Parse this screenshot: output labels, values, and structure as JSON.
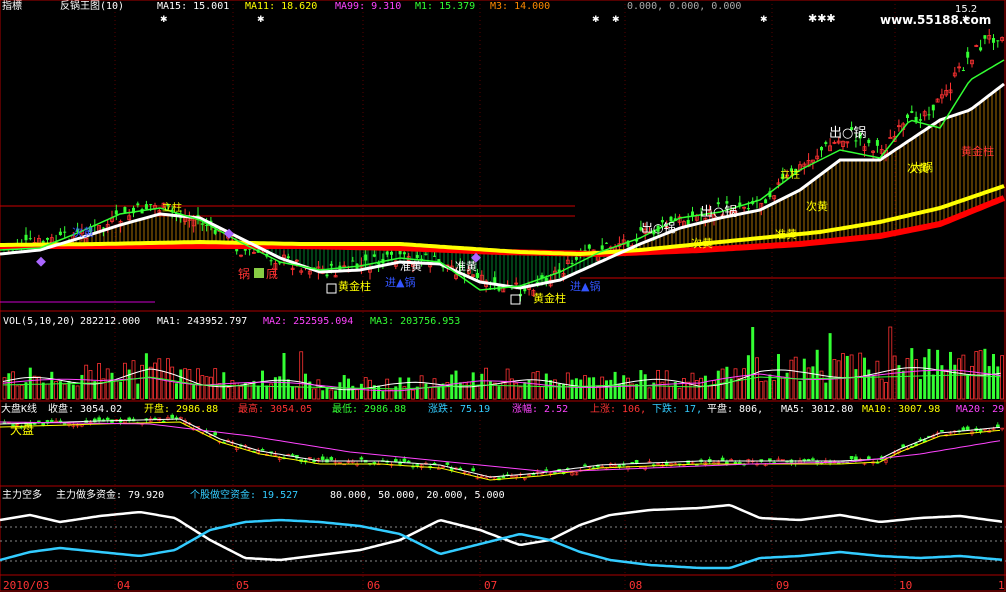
{
  "header": {
    "prefix": "指標",
    "name": "反锅王图(10)",
    "ma15": "MA15: 15.001",
    "ma11": "MA11: 18.620",
    "ma99": "MA99: 9.310",
    "m1": "M1: 15.379",
    "m3": "M3: 14.000",
    "vals": "0.000, 0.000, 0.000",
    "watermark": "www.55188.com",
    "last_price": "15.2"
  },
  "price_annotations": [
    {
      "text": "出○锅",
      "color": "#ffffff"
    },
    {
      "text": "出○锅",
      "color": "#ffffff"
    },
    {
      "text": "出○锅",
      "color": "#ffffff"
    },
    {
      "text": "次黄",
      "color": "#ffff00"
    },
    {
      "text": "准黄",
      "color": "#ffff00"
    },
    {
      "text": "次黄",
      "color": "#ffff00"
    },
    {
      "text": "次黄",
      "color": "#ffff00"
    },
    {
      "text": "准黄",
      "color": "#ffffff"
    },
    {
      "text": "准黄",
      "color": "#ffffff"
    },
    {
      "text": "黄金柱",
      "color": "#ffff00"
    },
    {
      "text": "黄金柱",
      "color": "#ffff00"
    },
    {
      "text": "锅",
      "color": "#ff3333"
    },
    {
      "text": "底",
      "color": "#ff3333"
    },
    {
      "text": "进▲锅",
      "color": "#3355ff"
    },
    {
      "text": "进▲锅",
      "color": "#3355ff"
    },
    {
      "text": "立柱",
      "color": "#ffff00"
    },
    {
      "text": "立柱",
      "color": "#ffff00"
    },
    {
      "text": "黄金柱",
      "color": "#ff3333"
    },
    {
      "text": "大锅",
      "color": "#ffff00"
    },
    {
      "text": "次黄",
      "color": "#3355ff"
    }
  ],
  "vol_panel": {
    "label": "VOL(5,10,20)",
    "vol": "282212.000",
    "ma1": "MA1: 243952.797",
    "ma2": "MA2: 252595.094",
    "ma3": "MA3: 203756.953"
  },
  "index_panel": {
    "label": "大盘K线",
    "close": "收盘: 3054.02",
    "open": "开盘: 2986.88",
    "high": "最高: 3054.05",
    "low": "最低: 2986.88",
    "change": "涨跌: 75.19",
    "pct": "涨幅: 2.52",
    "up": "上涨: 106,",
    "down": "下跌: 17,",
    "flat": "平盘: 806,",
    "ma5": "MA5: 3012.80",
    "ma10": "MA10: 3007.98",
    "ma20": "MA20: 29",
    "tag": "大盘"
  },
  "flow_panel": {
    "label": "主力空多",
    "main": "主力做多资金: 79.920",
    "retail": "个股做空资金: 19.527",
    "levels": "80.000, 50.000, 20.000, 5.000"
  },
  "date_axis": [
    "2010/03",
    "04",
    "05",
    "06",
    "07",
    "08",
    "09",
    "10",
    "1"
  ],
  "colors": {
    "up": "#ff3232",
    "down": "#00dddd",
    "ma_white": "#ffffff",
    "ma_yellow": "#ffff00",
    "ma_red": "#ff0000",
    "green": "#33ff33",
    "magenta": "#ff44ff",
    "cyan": "#33ccff",
    "grid": "#aa0000"
  }
}
